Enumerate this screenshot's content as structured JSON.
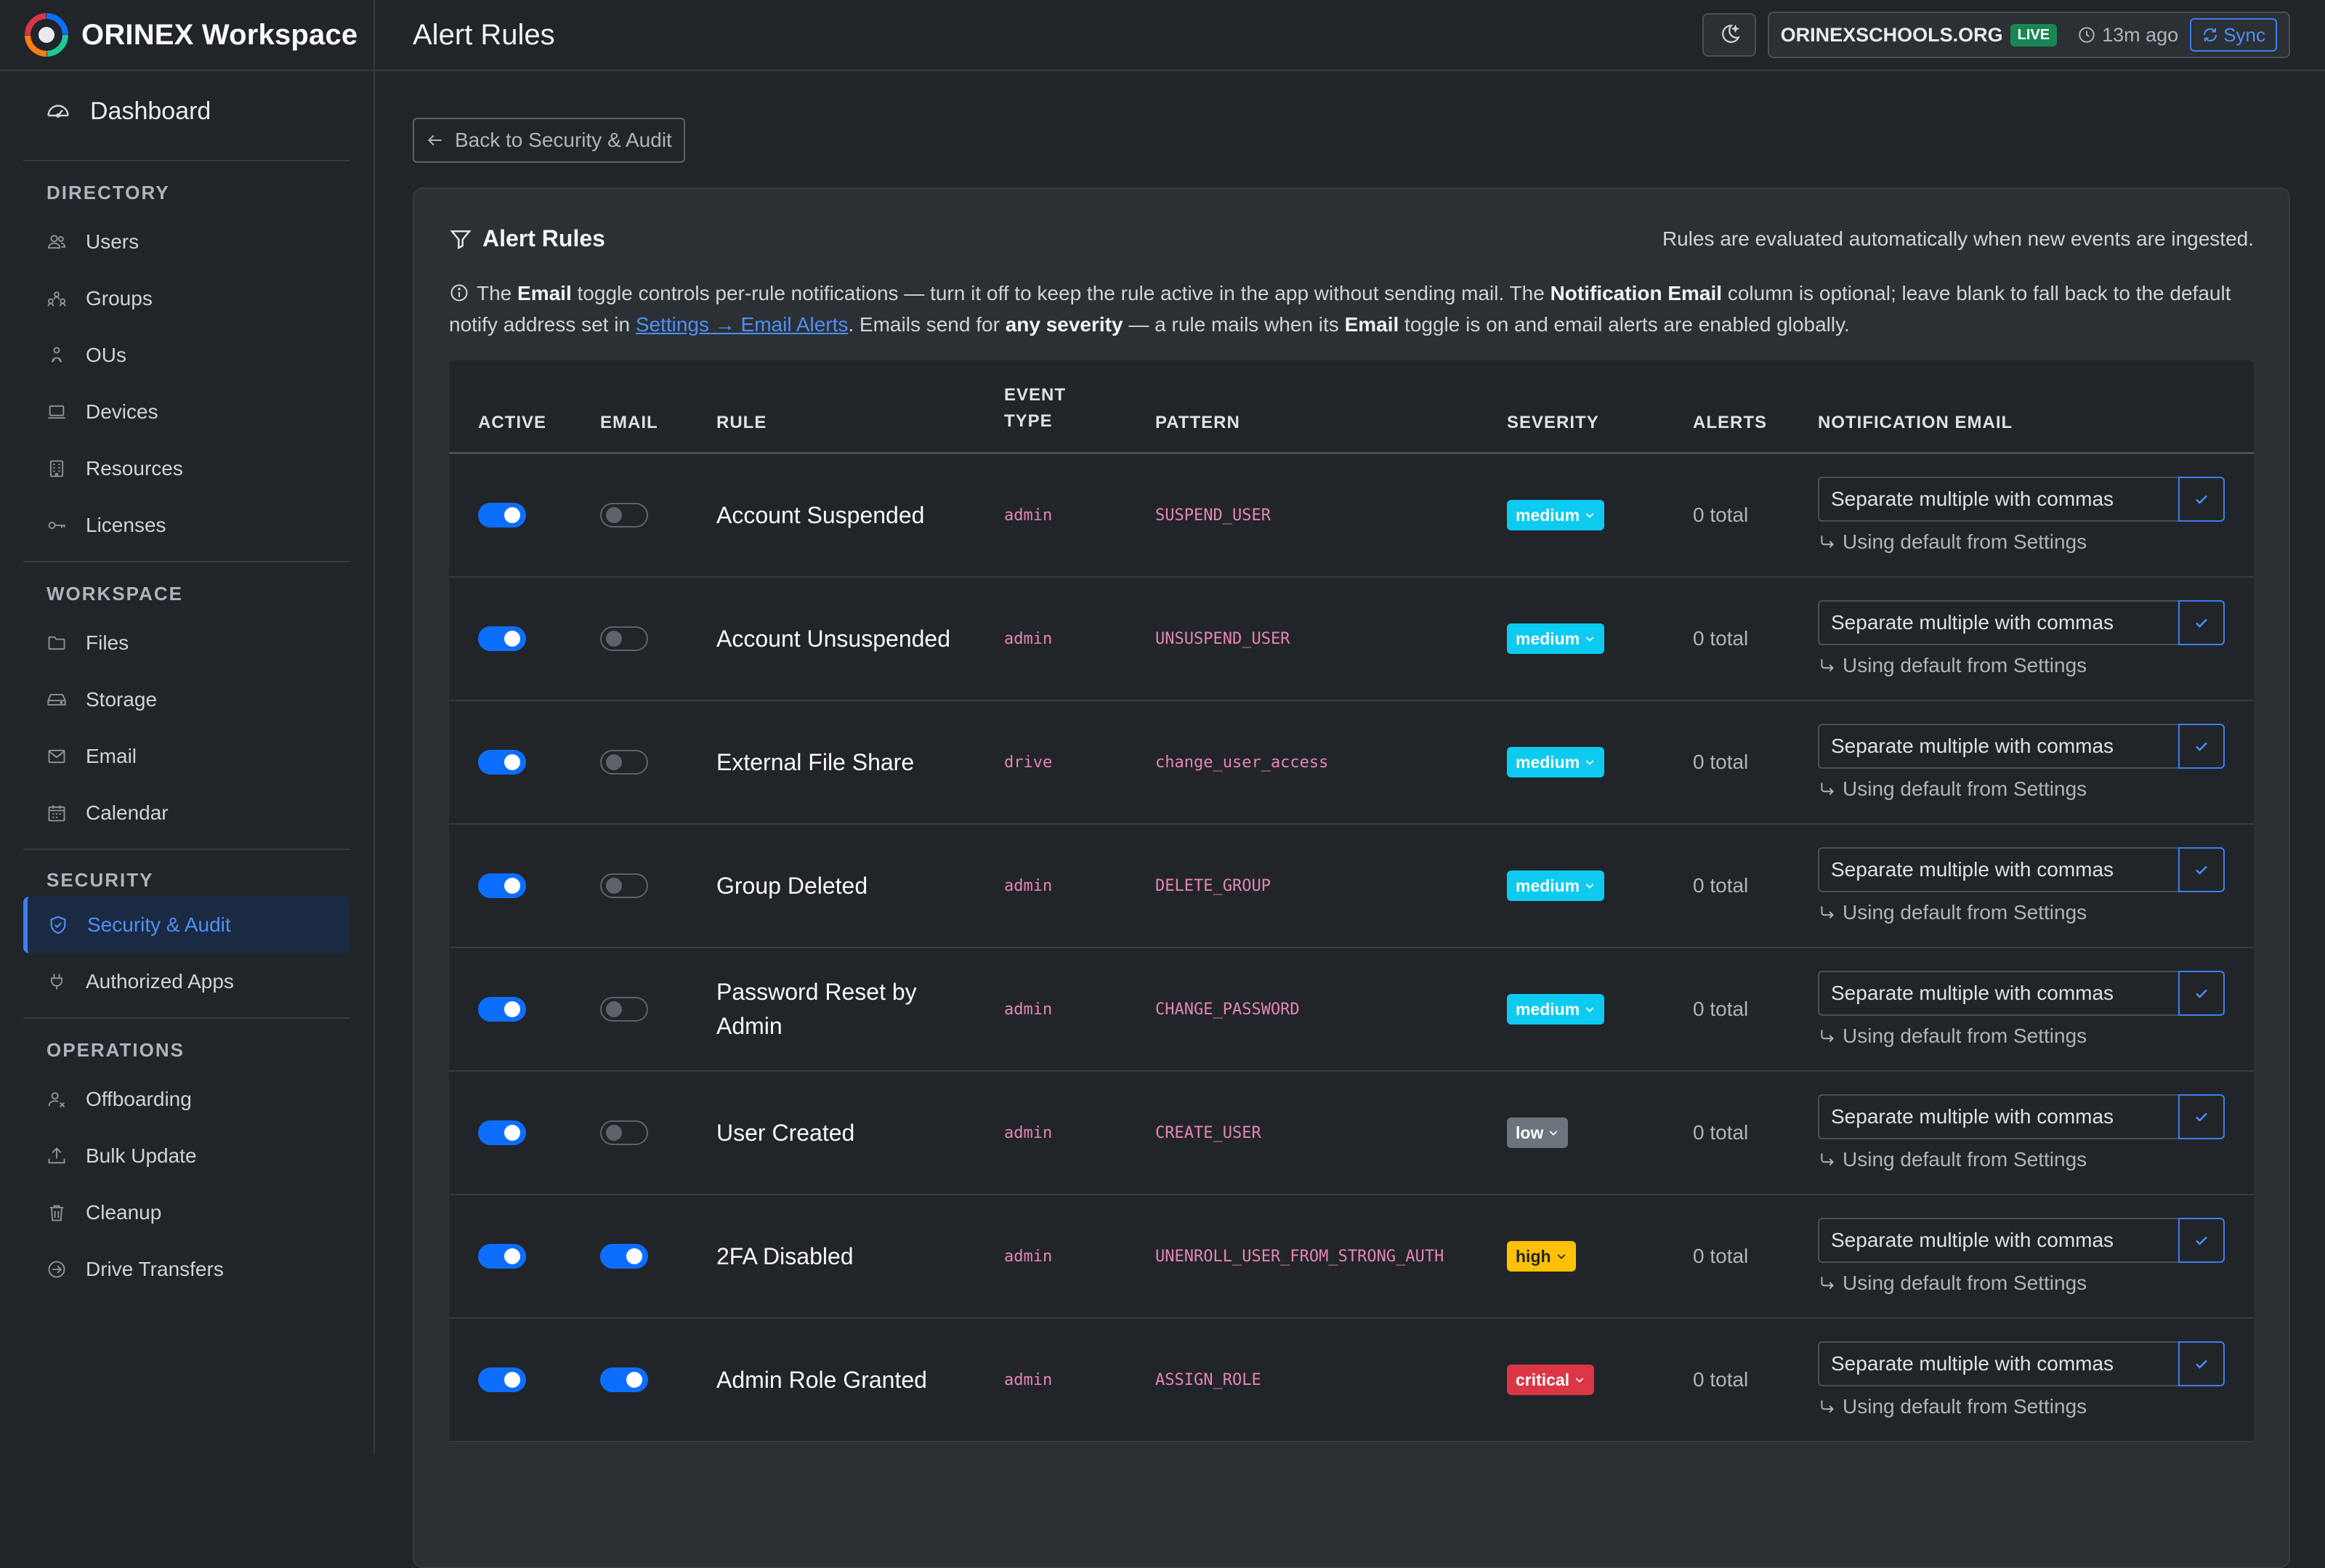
{
  "app": {
    "title": "ORINEX Workspace"
  },
  "sidebar": {
    "dashboard": "Dashboard",
    "sections": [
      {
        "title": "DIRECTORY",
        "items": [
          {
            "label": "Users",
            "icon": "users-icon"
          },
          {
            "label": "Groups",
            "icon": "groups-icon"
          },
          {
            "label": "OUs",
            "icon": "ou-icon"
          },
          {
            "label": "Devices",
            "icon": "laptop-icon"
          },
          {
            "label": "Resources",
            "icon": "building-icon"
          },
          {
            "label": "Licenses",
            "icon": "key-icon"
          }
        ]
      },
      {
        "title": "WORKSPACE",
        "items": [
          {
            "label": "Files",
            "icon": "folder-icon"
          },
          {
            "label": "Storage",
            "icon": "hdd-icon"
          },
          {
            "label": "Email",
            "icon": "envelope-icon"
          },
          {
            "label": "Calendar",
            "icon": "calendar-icon"
          }
        ]
      },
      {
        "title": "SECURITY",
        "items": [
          {
            "label": "Security & Audit",
            "icon": "shield-icon",
            "active": true
          },
          {
            "label": "Authorized Apps",
            "icon": "plug-icon"
          }
        ]
      },
      {
        "title": "OPERATIONS",
        "items": [
          {
            "label": "Offboarding",
            "icon": "person-off-icon"
          },
          {
            "label": "Bulk Update",
            "icon": "upload-icon"
          },
          {
            "label": "Cleanup",
            "icon": "trash-icon"
          },
          {
            "label": "Drive Transfers",
            "icon": "arrow-circle-icon"
          }
        ]
      }
    ]
  },
  "topbar": {
    "page_title": "Alert Rules",
    "org": "ORINEXSCHOOLS.ORG",
    "live": "LIVE",
    "last_sync": "13m ago",
    "sync_label": "Sync"
  },
  "back_label": "Back to Security & Audit",
  "card": {
    "title": "Alert Rules",
    "note": "Rules are evaluated automatically when new events are ingested.",
    "info": {
      "p1": "The ",
      "b1": "Email",
      "p2": " toggle controls per-rule notifications — turn it off to keep the rule active in the app without sending mail. The ",
      "b2": "Notification Email",
      "p3": " column is optional; leave blank to fall back to the default notify address set in ",
      "link": "Settings → Email Alerts",
      "p4": ". Emails send for ",
      "b3": "any severity",
      "p5": " — a rule mails when its ",
      "b4": "Email",
      "p6": " toggle is on and email alerts are enabled globally."
    }
  },
  "table": {
    "headers": {
      "active": "ACTIVE",
      "email": "EMAIL",
      "rule": "RULE",
      "event_type_1": "EVENT",
      "event_type_2": "TYPE",
      "pattern": "PATTERN",
      "severity": "SEVERITY",
      "alerts": "ALERTS",
      "notification_email": "NOTIFICATION EMAIL"
    },
    "email_placeholder": "Separate multiple with commas",
    "email_hint": "Using default from Settings",
    "severity_colors": {
      "medium": "#0dcaf0",
      "low": "#6c757d",
      "high": "#ffc107",
      "critical": "#dc3545"
    },
    "rows": [
      {
        "active": true,
        "email": false,
        "rule": "Account Suspended",
        "event_type": "admin",
        "pattern": "SUSPEND_USER",
        "severity": "medium",
        "alerts": "0 total"
      },
      {
        "active": true,
        "email": false,
        "rule": "Account Unsuspended",
        "event_type": "admin",
        "pattern": "UNSUSPEND_USER",
        "severity": "medium",
        "alerts": "0 total"
      },
      {
        "active": true,
        "email": false,
        "rule": "External File Share",
        "event_type": "drive",
        "pattern": "change_user_access",
        "severity": "medium",
        "alerts": "0 total"
      },
      {
        "active": true,
        "email": false,
        "rule": "Group Deleted",
        "event_type": "admin",
        "pattern": "DELETE_GROUP",
        "severity": "medium",
        "alerts": "0 total"
      },
      {
        "active": true,
        "email": false,
        "rule": "Password Reset by Admin",
        "event_type": "admin",
        "pattern": "CHANGE_PASSWORD",
        "severity": "medium",
        "alerts": "0 total"
      },
      {
        "active": true,
        "email": false,
        "rule": "User Created",
        "event_type": "admin",
        "pattern": "CREATE_USER",
        "severity": "low",
        "alerts": "0 total"
      },
      {
        "active": true,
        "email": true,
        "rule": "2FA Disabled",
        "event_type": "admin",
        "pattern": "UNENROLL_USER_FROM_STRONG_AUTH",
        "severity": "high",
        "alerts": "0 total"
      },
      {
        "active": true,
        "email": true,
        "rule": "Admin Role Granted",
        "event_type": "admin",
        "pattern": "ASSIGN_ROLE",
        "severity": "critical",
        "alerts": "0 total"
      }
    ]
  }
}
